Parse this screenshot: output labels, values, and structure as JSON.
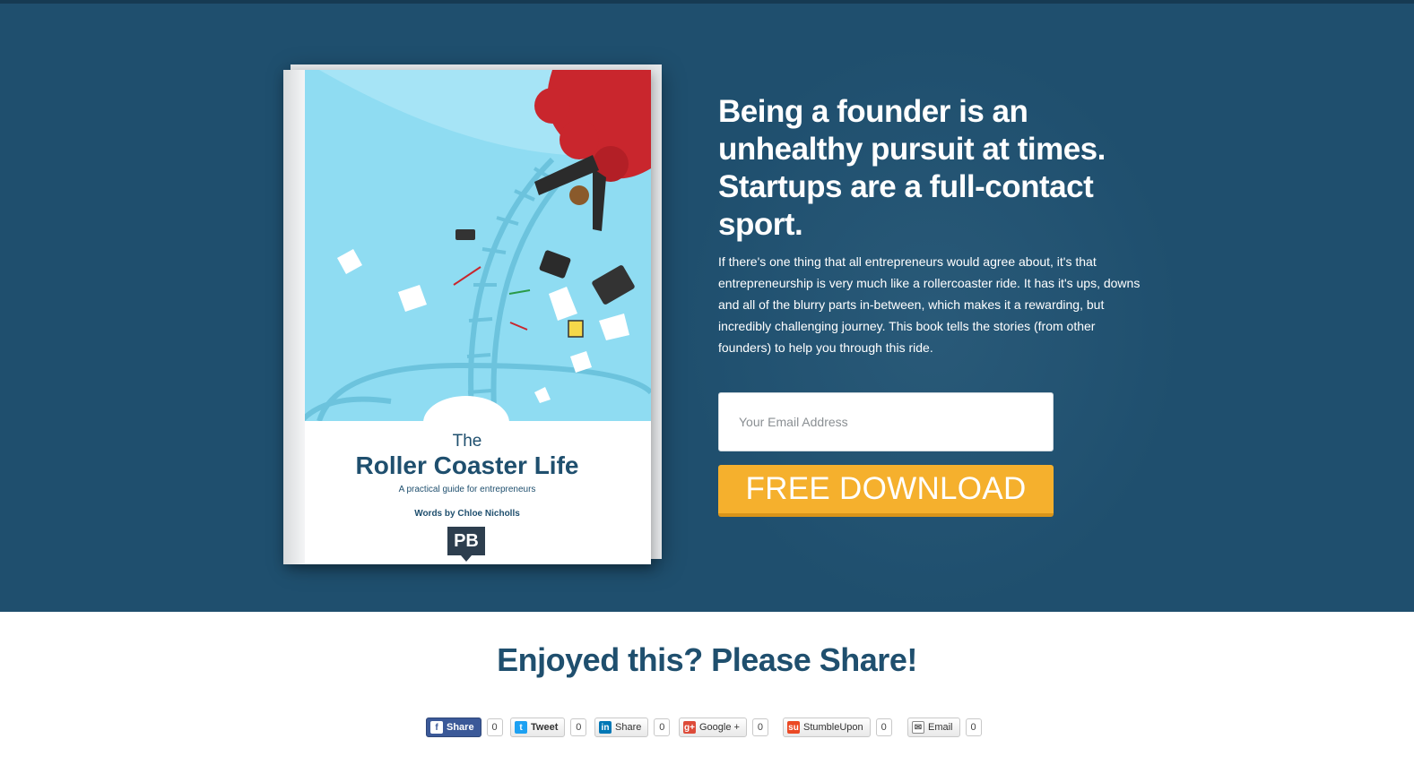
{
  "hero": {
    "headline": "Being a founder is an unhealthy pursuit at times. Startups are a full-contact sport.",
    "intro": "If there's one thing that all entrepreneurs would agree about, it's that entrepreneurship is very much like a rollercoaster ride. It has it's ups, downs and all of the blurry parts in-between, which makes it a rewarding, but incredibly challenging journey. This book tells the stories (from other founders) to help you through this ride.",
    "email_placeholder": "Your Email Address",
    "download_label": "FREE DOWNLOAD",
    "background_color": "#1f4f6e",
    "accent_color": "#f5b02d"
  },
  "book": {
    "title_prefix": "The",
    "title": "Roller Coaster Life",
    "subtitle": "A practical guide for entrepreneurs",
    "author": "Words by Chloe Nicholls",
    "logo": "PB"
  },
  "share": {
    "heading": "Enjoyed this? Please Share!",
    "buttons": [
      {
        "label": "Share",
        "icon": "facebook-icon",
        "count": "0"
      },
      {
        "label": "Tweet",
        "icon": "twitter-icon",
        "count": "0"
      },
      {
        "label": "Share",
        "icon": "linkedin-icon",
        "count": "0"
      },
      {
        "label": "Google +",
        "icon": "google-plus-icon",
        "count": "0"
      },
      {
        "label": "StumbleUpon",
        "icon": "stumbleupon-icon",
        "count": "0"
      },
      {
        "label": "Email",
        "icon": "email-icon",
        "count": "0"
      }
    ]
  }
}
